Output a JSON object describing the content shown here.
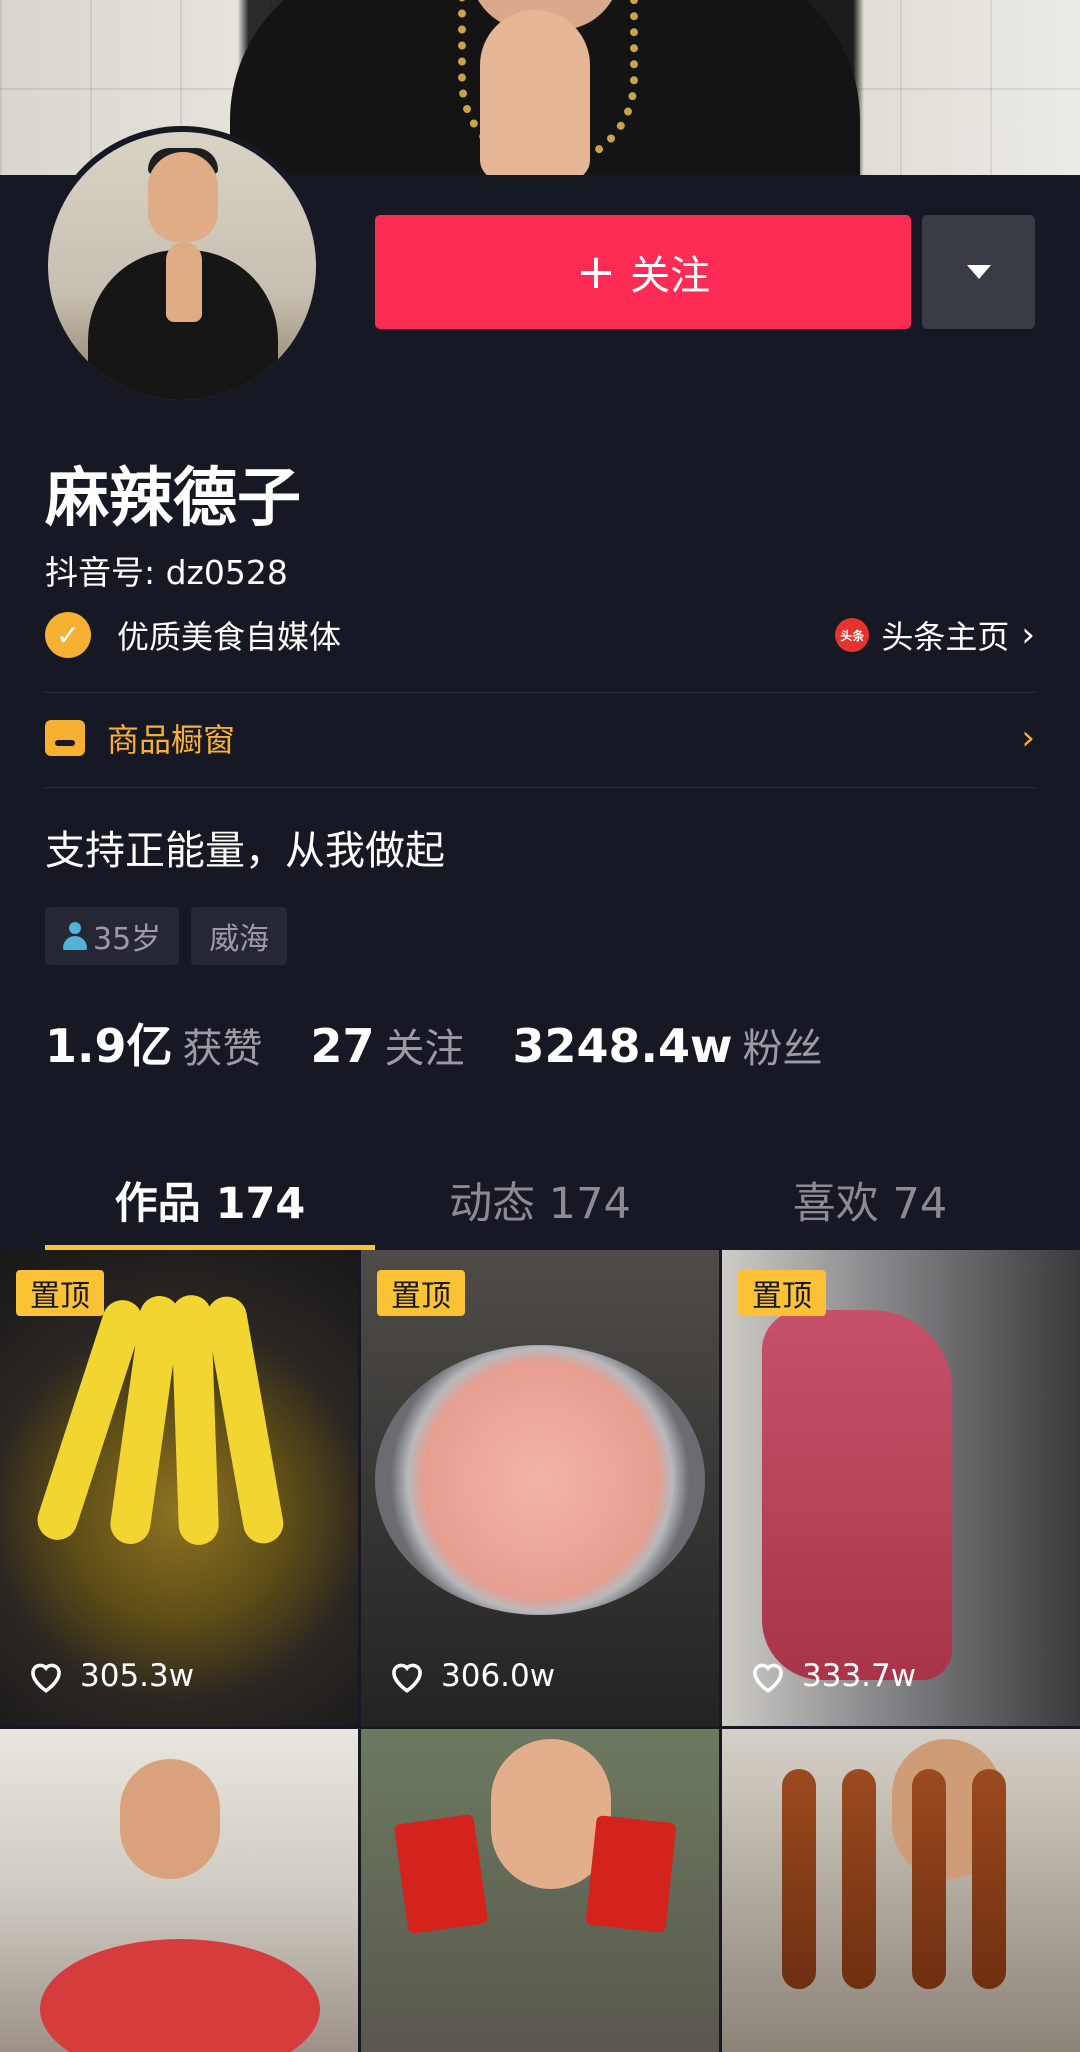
{
  "profile": {
    "follow_label": "关注",
    "nickname": "麻辣德子",
    "douyin_id": "抖音号: dz0528",
    "verification": "优质美食自媒体",
    "toutiao_label": "头条主页",
    "toutiao_badge": "头条",
    "shop_label": "商品橱窗",
    "bio": "支持正能量，从我做起",
    "tags": {
      "age": "35岁",
      "city": "威海"
    }
  },
  "stats": {
    "likes_num": "1.9亿",
    "likes_label": "获赞",
    "following_num": "27",
    "following_label": "关注",
    "fans_num": "3248.4w",
    "fans_label": "粉丝"
  },
  "tabs": [
    "作品 174",
    "动态 174",
    "喜欢 74"
  ],
  "videos": {
    "pin_label": "置顶",
    "likes": [
      "305.3w",
      "306.0w",
      "333.7w"
    ]
  },
  "colors": {
    "background": "#161823",
    "follow_button": "#fe2c55",
    "accent_yellow": "#fcc236",
    "muted_text": "#9a9ba4"
  },
  "icons": [
    "plus-icon",
    "dropdown-triangle-icon",
    "check-badge-icon",
    "toutiao-icon",
    "chevron-right-icon",
    "shop-icon",
    "person-icon",
    "heart-icon"
  ]
}
